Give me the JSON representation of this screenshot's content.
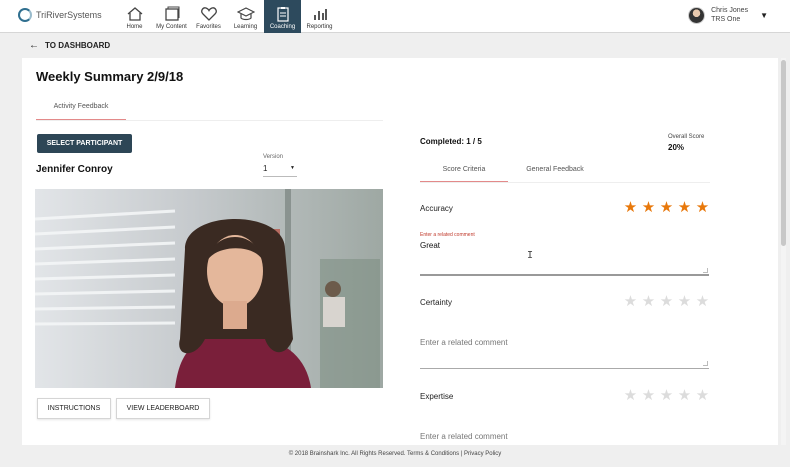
{
  "brand": {
    "name": "TriRiverSystems"
  },
  "nav": {
    "items": [
      {
        "label": "Home",
        "icon": "home-icon"
      },
      {
        "label": "My Content",
        "icon": "folder-icon"
      },
      {
        "label": "Favorites",
        "icon": "heart-icon"
      },
      {
        "label": "Learning",
        "icon": "graduation-cap-icon"
      },
      {
        "label": "Coaching",
        "icon": "clipboard-icon",
        "active": true
      },
      {
        "label": "Reporting",
        "icon": "bar-chart-icon"
      }
    ]
  },
  "user": {
    "name": "Chris Jones",
    "org": "TRS One"
  },
  "back_link": "TO DASHBOARD",
  "page": {
    "title": "Weekly Summary 2/9/18"
  },
  "tabs": {
    "activity": "Activity Feedback"
  },
  "left": {
    "select_button": "SELECT PARTICIPANT",
    "participant": "Jennifer Conroy",
    "version_label": "Version",
    "version_value": "1",
    "instructions_button": "INSTRUCTIONS",
    "leaderboard_button": "VIEW LEADERBOARD"
  },
  "right": {
    "completed": "Completed: 1 / 5",
    "overall_label": "Overall Score",
    "overall_value": "20%",
    "tabs": {
      "score": "Score Criteria",
      "general": "General Feedback"
    },
    "criteria": [
      {
        "label": "Accuracy",
        "rating": 5,
        "max": 5,
        "hint": "Enter a related comment",
        "comment": "Great",
        "placeholder": ""
      },
      {
        "label": "Certainty",
        "rating": 0,
        "max": 5,
        "hint": "",
        "comment": "",
        "placeholder": "Enter a related comment"
      },
      {
        "label": "Expertise",
        "rating": 0,
        "max": 5,
        "hint": "",
        "comment": "",
        "placeholder": "Enter a related comment"
      }
    ]
  },
  "footer": "© 2018 Brainshark Inc. All Rights Reserved. Terms & Conditions | Privacy Policy",
  "colors": {
    "nav_active": "#2d4a5d",
    "star_on": "#e8780b",
    "tab_accent": "#e38a8a",
    "hint_red": "#c0392b"
  }
}
